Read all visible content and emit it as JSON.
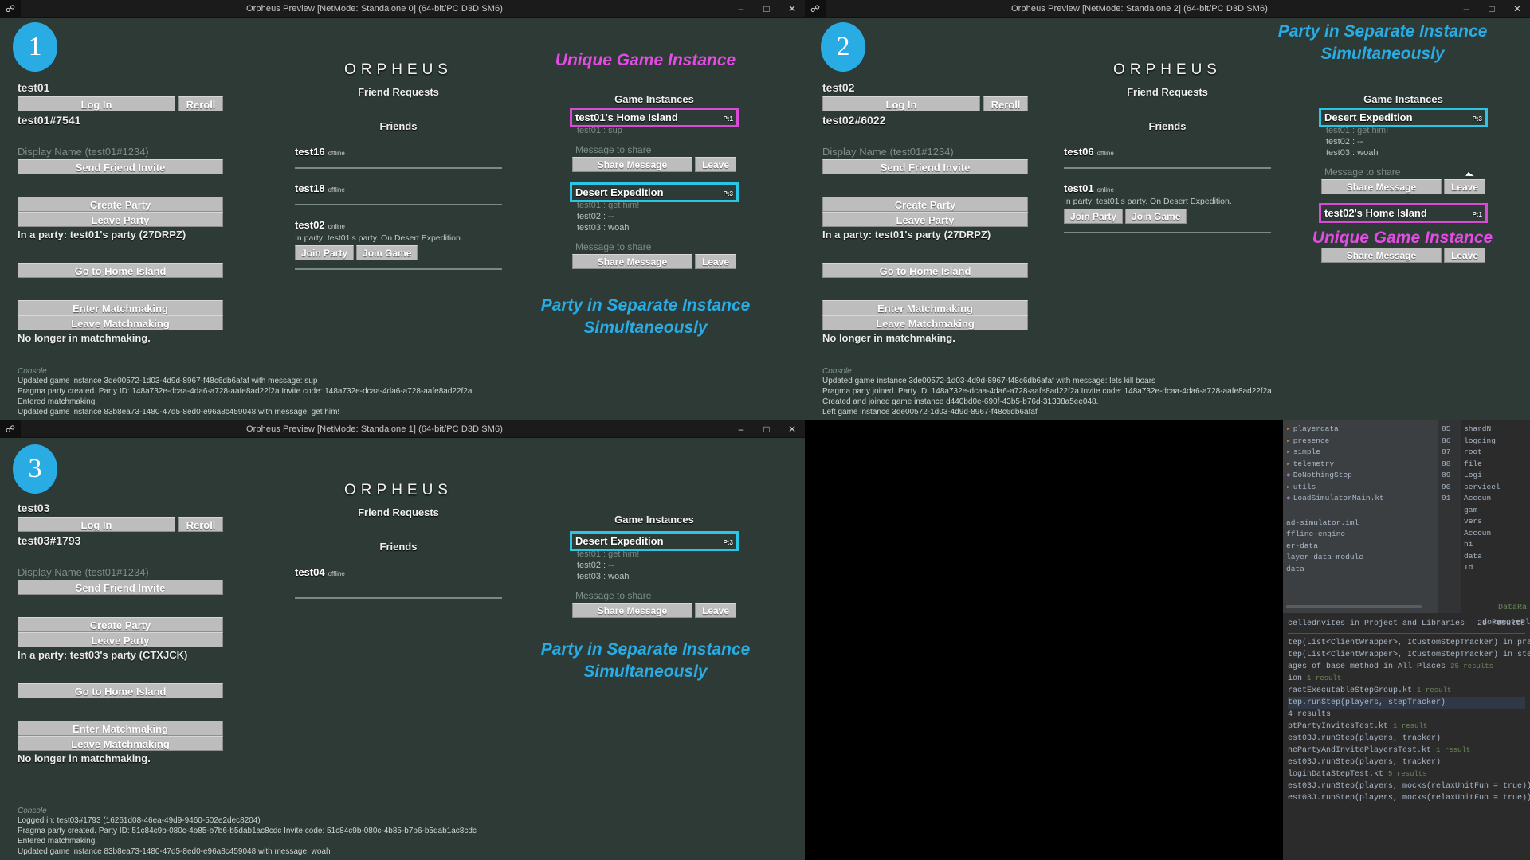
{
  "windows": [
    {
      "id": "w1",
      "title": "Orpheus Preview [NetMode: Standalone 0]  (64-bit/PC D3D SM6)",
      "account": {
        "name": "test01",
        "login_label": "Log In",
        "reroll_label": "Reroll",
        "tag": "test01#7541",
        "display_name_placeholder": "Display Name (test01#1234)",
        "send_invite_label": "Send Friend Invite",
        "create_party_label": "Create Party",
        "leave_party_label": "Leave Party",
        "party_status": "In a party: test01's party (27DRPZ)",
        "home_island_label": "Go to Home Island",
        "enter_mm_label": "Enter Matchmaking",
        "leave_mm_label": "Leave Matchmaking",
        "mm_status": "No longer in matchmaking."
      },
      "social": {
        "brand": "ORPHEUS",
        "friend_requests_header": "Friend Requests",
        "friends_header": "Friends",
        "friends": [
          {
            "name": "test16",
            "status": "offline",
            "meta": "",
            "actions": []
          },
          {
            "name": "test18",
            "status": "offline",
            "meta": "",
            "actions": []
          },
          {
            "name": "test02",
            "status": "online",
            "meta": "In party: test01's party. On Desert Expedition.",
            "actions": [
              "Join Party",
              "Join Game"
            ]
          }
        ]
      },
      "instances": {
        "header": "Game Instances",
        "items": [
          {
            "title": "test01's Home Island",
            "players_tag": "P:1",
            "players": [
              "test01 : sup"
            ],
            "message_placeholder": "Message to share",
            "share_label": "Share Message",
            "leave_label": "Leave",
            "highlight": "pink"
          },
          {
            "title": "Desert Expedition",
            "players_tag": "P:3",
            "players": [
              "test01 : get him!",
              "test02 : --",
              "test03 : woah"
            ],
            "message_placeholder": "Message to share",
            "share_label": "Share Message",
            "leave_label": "Leave",
            "highlight": "cyan"
          }
        ]
      },
      "console": {
        "header": "Console",
        "lines": [
          "Updated game instance 3de00572-1d03-4d9d-8967-f48c6db6afaf with message: sup",
          "Pragma party created. Party ID: 148a732e-dcaa-4da6-a728-aafe8ad22f2a Invite code: 148a732e-dcaa-4da6-a728-aafe8ad22f2a",
          "Entered matchmaking.",
          "Updated game instance 83b8ea73-1480-47d5-8ed0-e96a8c459048 with message: get him!"
        ]
      }
    },
    {
      "id": "w2",
      "title": "Orpheus Preview [NetMode: Standalone 2]  (64-bit/PC D3D SM6)",
      "account": {
        "name": "test02",
        "login_label": "Log In",
        "reroll_label": "Reroll",
        "tag": "test02#6022",
        "display_name_placeholder": "Display Name (test01#1234)",
        "send_invite_label": "Send Friend Invite",
        "create_party_label": "Create Party",
        "leave_party_label": "Leave Party",
        "party_status": "In a party: test01's party (27DRPZ)",
        "home_island_label": "Go to Home Island",
        "enter_mm_label": "Enter Matchmaking",
        "leave_mm_label": "Leave Matchmaking",
        "mm_status": "No longer in matchmaking."
      },
      "social": {
        "brand": "ORPHEUS",
        "friend_requests_header": "Friend Requests",
        "friends_header": "Friends",
        "friends": [
          {
            "name": "test06",
            "status": "offline",
            "meta": "",
            "actions": []
          },
          {
            "name": "test01",
            "status": "online",
            "meta": "In party: test01's party. On Desert Expedition.",
            "actions": [
              "Join Party",
              "Join Game"
            ]
          }
        ]
      },
      "instances": {
        "header": "Game Instances",
        "items": [
          {
            "title": "Desert Expedition",
            "players_tag": "P:3",
            "players": [
              "test01 : get him!",
              "test02 : --",
              "test03 : woah"
            ],
            "message_placeholder": "Message to share",
            "share_label": "Share Message",
            "leave_label": "Leave",
            "highlight": "cyan"
          },
          {
            "title": "test02's Home Island",
            "players_tag": "P:1",
            "players": [],
            "message_placeholder": "",
            "share_label": "Share Message",
            "leave_label": "Leave",
            "highlight": "pink"
          }
        ]
      },
      "console": {
        "header": "Console",
        "lines": [
          "Updated game instance 3de00572-1d03-4d9d-8967-f48c6db6afaf with message: lets kill boars",
          "Pragma party joined. Party ID: 148a732e-dcaa-4da6-a728-aafe8ad22f2a Invite code: 148a732e-dcaa-4da6-a728-aafe8ad22f2a",
          "Created and joined game instance d440bd0e-690f-43b5-b76d-31338a5ee048.",
          "Left game instance 3de00572-1d03-4d9d-8967-f48c6db6afaf"
        ]
      }
    },
    {
      "id": "w3",
      "title": "Orpheus Preview [NetMode: Standalone 1]  (64-bit/PC D3D SM6)",
      "account": {
        "name": "test03",
        "login_label": "Log In",
        "reroll_label": "Reroll",
        "tag": "test03#1793",
        "display_name_placeholder": "Display Name (test01#1234)",
        "send_invite_label": "Send Friend Invite",
        "create_party_label": "Create Party",
        "leave_party_label": "Leave Party",
        "party_status": "In a party: test03's party (CTXJCK)",
        "home_island_label": "Go to Home Island",
        "enter_mm_label": "Enter Matchmaking",
        "leave_mm_label": "Leave Matchmaking",
        "mm_status": "No longer in matchmaking."
      },
      "social": {
        "brand": "ORPHEUS",
        "friend_requests_header": "Friend Requests",
        "friends_header": "Friends",
        "friends": [
          {
            "name": "test04",
            "status": "offline",
            "meta": "",
            "actions": []
          }
        ]
      },
      "instances": {
        "header": "Game Instances",
        "items": [
          {
            "title": "Desert Expedition",
            "players_tag": "P:3",
            "players": [
              "test01 : get him!",
              "test02 : --",
              "test03 : woah"
            ],
            "message_placeholder": "Message to share",
            "share_label": "Share Message",
            "leave_label": "Leave",
            "highlight": "cyan"
          }
        ]
      },
      "console": {
        "header": "Console",
        "lines": [
          "Logged in: test03#1793 (16261d08-46ea-49d9-9460-502e2dec8204)",
          "Pragma party created. Party ID: 51c84c9b-080c-4b85-b7b6-b5dab1ac8cdc Invite code: 51c84c9b-080c-4b85-b7b6-b5dab1ac8cdc",
          "Entered matchmaking.",
          "Updated game instance 83b8ea73-1480-47d5-8ed0-e96a8c459048 with message: woah"
        ]
      }
    }
  ],
  "annotations": {
    "badges": [
      "1",
      "2",
      "3"
    ],
    "unique_instance_1": "Unique Game Instance",
    "unique_instance_2": "Unique Game Instance",
    "party_separate_1": "Party in Separate Instance\nSimultaneously",
    "party_separate_2": "Party in Separate Instance\nSimultaneously",
    "party_separate_3": "Party in Separate Instance\nSimultaneously",
    "colors": {
      "badge": "#29ace3",
      "cyan": "#29ace3",
      "pink": "#e34be3",
      "line": "#1e7fc8"
    }
  },
  "ide": {
    "tree": [
      {
        "icon": "folder",
        "label": "playerdata",
        "num": "85"
      },
      {
        "icon": "folder",
        "label": "presence",
        "num": "86"
      },
      {
        "icon": "folder",
        "label": "simple",
        "num": "87"
      },
      {
        "icon": "folder",
        "label": "telemetry",
        "num": "88"
      },
      {
        "icon": "kotlin",
        "label": "DoNothingStep",
        "num": "89"
      },
      {
        "icon": "folder",
        "label": "utils",
        "num": "90"
      },
      {
        "icon": "kotlin",
        "label": "LoadSimulatorMain.kt",
        "num": "91"
      }
    ],
    "tree_right": [
      "shardN",
      "logging",
      "root",
      "file",
      "Logi",
      "servicel",
      "Accoun",
      "gam",
      "vers",
      "Accoun",
      "hi",
      "data",
      "Id"
    ],
    "left_files": [
      "ad-simulator.iml",
      "ffline-engine",
      "er-data",
      "layer-data-module",
      "data"
    ],
    "find_header": "cellednvites in Project and Libraries",
    "find_count": "25 results",
    "find_right_header": "doRemovePlayers in P",
    "results": [
      {
        "text": "tep(List<ClientWrapper>, ICustomStepTracker) in pragma.loadin",
        "count": ""
      },
      {
        "text": "tep(List<ClientWrapper>, ICustomStepTracker) in steps.multipla",
        "count": ""
      },
      {
        "text": "ages of base method in All Places",
        "count": "25 results"
      },
      {
        "text": "ion",
        "count": "1 result"
      },
      {
        "text": "ractExecutableStepGroup.kt",
        "count": "1 result"
      },
      {
        "text": "tep.runStep(players, stepTracker)",
        "count": ""
      },
      {
        "text": "4 results",
        "count": ""
      },
      {
        "text": "ptPartyInvitesTest.kt",
        "count": "1 result"
      },
      {
        "text": "est03J.runStep(players, tracker)",
        "count": ""
      },
      {
        "text": "nePartyAndInvitePlayersTest.kt",
        "count": "1 result"
      },
      {
        "text": "est03J.runStep(players, tracker)",
        "count": ""
      },
      {
        "text": "loginDataStepTest.kt",
        "count": "5 results"
      },
      {
        "text": "est03J.runStep(players, mocks(relaxUnitFun = true))",
        "count": ""
      },
      {
        "text": "est03J.runStep(players, mocks(relaxUnitFun = true))",
        "count": ""
      }
    ],
    "status_right": "DataRa"
  }
}
